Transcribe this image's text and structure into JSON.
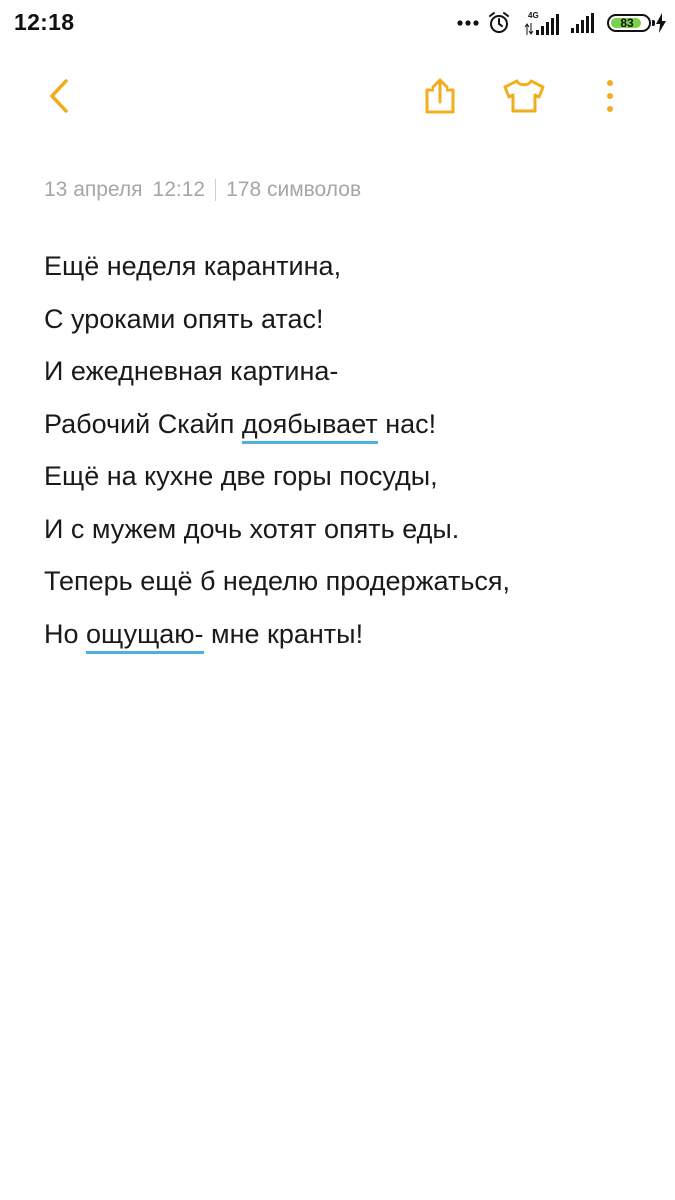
{
  "status_bar": {
    "time": "12:18",
    "network_label": "4G",
    "battery_level": "83",
    "icons": [
      "more-dots-icon",
      "alarm-clock-icon",
      "signal-4g-icon",
      "signal-icon",
      "battery-icon",
      "charging-bolt-icon"
    ]
  },
  "toolbar": {
    "accent_color": "#f0ae1e",
    "icons": [
      "back-arrow-icon",
      "share-icon",
      "t-shirt-theme-icon",
      "more-vertical-icon"
    ]
  },
  "note": {
    "date": "13 апреля",
    "time": "12:12",
    "char_count": "178 символов",
    "lines": [
      {
        "text": "Ещё неделя карантина,"
      },
      {
        "text": "С уроками опять атас!"
      },
      {
        "text": "И ежедневная картина-"
      },
      {
        "before": "Рабочий Скайп ",
        "misspelled": "доябывает",
        "after": " нас!"
      },
      {
        "text": "Ещё на кухне две горы посуды,"
      },
      {
        "text": "И с мужем дочь хотят опять еды."
      },
      {
        "text": "Теперь ещё б неделю продержаться,"
      },
      {
        "before": "Но ",
        "misspelled": "ощущаю-",
        "after": " мне кранты!"
      }
    ]
  },
  "colors": {
    "accent": "#f0ae1e",
    "spellcheck_underline": "#4db1df",
    "meta_text": "#a6a6a6",
    "body_text": "#1a1a1a",
    "battery_fill": "#7ad14a"
  }
}
